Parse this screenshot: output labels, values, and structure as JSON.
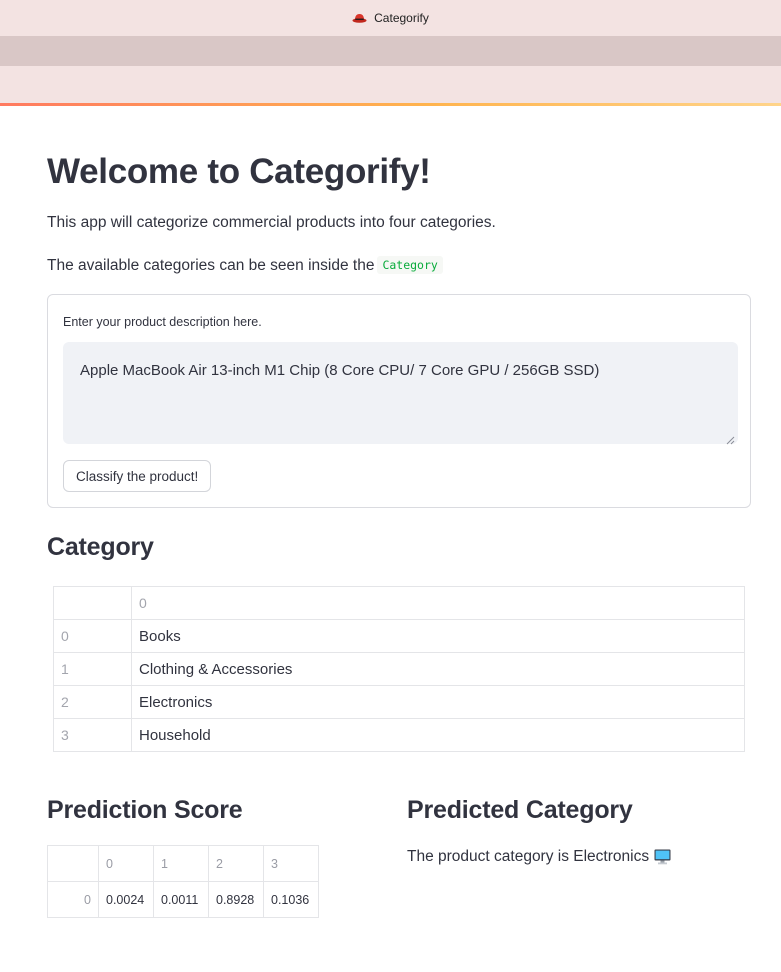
{
  "window": {
    "title": "Categorify",
    "icon": "red-hat-icon"
  },
  "page": {
    "title": "Welcome to Categorify!",
    "intro": "This app will categorize commercial products into four categories.",
    "categories_hint": "The available categories can be seen inside the",
    "categories_code": "Category"
  },
  "form": {
    "label": "Enter your product description here.",
    "value": "Apple MacBook Air 13-inch M1 Chip (8 Core CPU/ 7 Core GPU / 256GB SSD)",
    "button_label": "Classify the product!"
  },
  "category_section": {
    "heading": "Category",
    "column_header": "0",
    "rows": [
      {
        "index": "0",
        "value": "Books"
      },
      {
        "index": "1",
        "value": "Clothing & Accessories"
      },
      {
        "index": "2",
        "value": "Electronics"
      },
      {
        "index": "3",
        "value": "Household"
      }
    ]
  },
  "score_section": {
    "heading": "Prediction Score",
    "columns": [
      "0",
      "1",
      "2",
      "3"
    ],
    "row_index": "0",
    "values": [
      "0.0024",
      "0.0011",
      "0.8928",
      "0.1036"
    ]
  },
  "prediction_section": {
    "heading": "Predicted Category",
    "text": "The product category is Electronics",
    "icon": "desktop-computer-icon"
  },
  "colors": {
    "header_bg": "#f3e3e2",
    "toolbar_bg": "#d9c7c6",
    "text": "#31333f",
    "code_green": "#09ab3b",
    "input_bg": "#f0f2f6"
  }
}
